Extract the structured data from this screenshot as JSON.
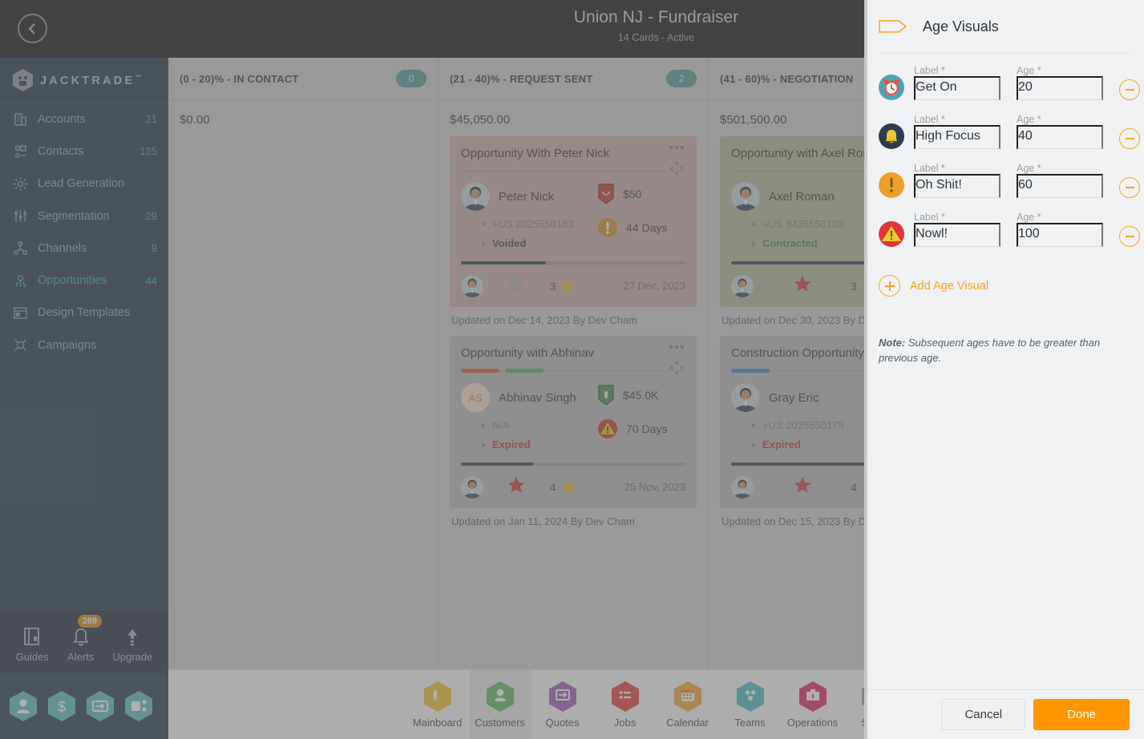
{
  "sidebar": {
    "brand": "JACKTRADE",
    "brand_tm": "™",
    "back_icon": "chevron-left-icon",
    "items": [
      {
        "label": "Accounts",
        "count": "21",
        "icon": "building-icon",
        "active": false
      },
      {
        "label": "Contacts",
        "count": "125",
        "icon": "contacts-icon",
        "active": false
      },
      {
        "label": "Lead Generation",
        "count": "",
        "icon": "lead-generation-icon",
        "active": false
      },
      {
        "label": "Segmentation",
        "count": "29",
        "icon": "segmentation-icon",
        "active": false
      },
      {
        "label": "Channels",
        "count": "9",
        "icon": "channels-icon",
        "active": false
      },
      {
        "label": "Opportunities",
        "count": "44",
        "icon": "opportunities-icon",
        "active": true
      },
      {
        "label": "Design Templates",
        "count": "",
        "icon": "design-templates-icon",
        "active": false
      },
      {
        "label": "Campaigns",
        "count": "",
        "icon": "campaigns-icon",
        "active": false
      }
    ],
    "bottom": [
      {
        "label": "Guides",
        "icon": "book-icon",
        "badge": ""
      },
      {
        "label": "Alerts",
        "icon": "bell-icon",
        "badge": "269"
      },
      {
        "label": "Upgrade",
        "icon": "upload-arrow-icon",
        "badge": ""
      }
    ],
    "hex_shortcuts": [
      "person-hex-icon",
      "dollar-hex-icon",
      "payment-hex-icon",
      "workflow-hex-icon"
    ]
  },
  "header": {
    "title": "Union NJ - Fundraiser",
    "subtitle": "14 Cards - Active",
    "next_icon": "chevron-right-icon"
  },
  "board": {
    "columns": [
      {
        "title": "(0 - 20)% - IN CONTACT",
        "count": "0",
        "total": "$0.00",
        "cards": []
      },
      {
        "title": "(21 - 40)% - REQUEST SENT",
        "count": "2",
        "total": "$45,050.00",
        "cards": [
          {
            "title": "Opportunity With Peter Nick",
            "bg": "#c8aaa6",
            "segments": [],
            "person": "Peter Nick",
            "avatar_type": "photo",
            "initials": "",
            "phone": "+US 2025550183",
            "status": "Voided",
            "status_class": "b-voided",
            "amount": "$50",
            "amount_icon": "shield-red-icon",
            "days": "44 Days",
            "days_icon": "warning-orange-circle-icon",
            "progress": 38,
            "rating_left": "star-grey-icon",
            "rating_count": "3",
            "rating_icon": "star-yellow-icon",
            "date": "27 Dec, 2023",
            "updated": "Updated on Dec 14, 2023 By Dev Cham"
          },
          {
            "title": "Opportunity with Abhinav",
            "bg": "#b9b9b9",
            "segments": [
              "#d4572a",
              "#4caf50"
            ],
            "person": "Abhinav Singh",
            "avatar_type": "initials",
            "initials": "AS",
            "phone": "N/A",
            "status": "Expired",
            "status_class": "b-expired",
            "amount": "$45.0K",
            "amount_icon": "shield-green-icon",
            "days": "70 Days",
            "days_icon": "warning-red-triangle-icon",
            "progress": 32,
            "rating_left": "star-red-icon",
            "rating_count": "4",
            "rating_icon": "star-yellow-icon",
            "date": "25 Nov, 2023",
            "updated": "Updated on Jan 11, 2024 By Dev Cham"
          }
        ]
      },
      {
        "title": "(41 - 60)% - NEGOTIATION",
        "count": "",
        "total": "$501,500.00",
        "cards": [
          {
            "title": "Opportunity with Axel Roman",
            "bg": "#b3b79c",
            "segments": [],
            "person": "Axel Roman",
            "avatar_type": "photo",
            "initials": "",
            "phone": "+US 8435550109",
            "status": "Contracted",
            "status_class": "b-contracted",
            "amount": "",
            "amount_icon": "",
            "days": "",
            "days_icon": "",
            "progress": 100,
            "rating_left": "star-red-icon",
            "rating_count": "3",
            "rating_icon": "star-yellow-icon",
            "date": "",
            "updated": "Updated on Dec 30, 2023 By D"
          },
          {
            "title": "Construction Opportunity Eric",
            "bg": "#b9b9b9",
            "segments": [
              "#3f7fd0"
            ],
            "person": "Gray Eric",
            "avatar_type": "photo",
            "initials": "",
            "phone": "+US 2025550175",
            "status": "Expired",
            "status_class": "b-expired",
            "amount": "",
            "amount_icon": "",
            "days": "",
            "days_icon": "",
            "progress": 92,
            "rating_left": "star-red-icon",
            "rating_count": "4",
            "rating_icon": "star-yellow-icon",
            "date": "",
            "updated": "Updated on Dec 15, 2023 By D"
          }
        ]
      }
    ]
  },
  "appbar": {
    "items": [
      {
        "label": "Mainboard",
        "icon": "mainboard-hex-icon",
        "color": "#f5c02e",
        "active": false
      },
      {
        "label": "Customers",
        "icon": "customers-hex-icon",
        "color": "#5cb85c",
        "active": true
      },
      {
        "label": "Quotes",
        "icon": "quotes-hex-icon",
        "color": "#9b59b6",
        "active": false
      },
      {
        "label": "Jobs",
        "icon": "jobs-hex-icon",
        "color": "#e23b3b",
        "active": false
      },
      {
        "label": "Calendar",
        "icon": "calendar-hex-icon",
        "color": "#f0a828",
        "active": false
      },
      {
        "label": "Teams",
        "icon": "teams-hex-icon",
        "color": "#45bcc4",
        "active": false
      },
      {
        "label": "Operations",
        "icon": "operations-hex-icon",
        "color": "#e0245e",
        "active": false
      },
      {
        "label": "Setup",
        "icon": "setup-hex-icon",
        "color": "#9e9e9e",
        "active": false
      }
    ],
    "avatar": "user-avatar"
  },
  "panel": {
    "tag_icon": "tag-outline-icon",
    "title": "Age Visuals",
    "label_caption": "Label *",
    "age_caption": "Age *",
    "rows": [
      {
        "icon": "alarm-clock-icon",
        "label": "Get On",
        "age": "20",
        "minus_icon": "minus-circle-icon"
      },
      {
        "icon": "bell-icon",
        "label": "High Focus",
        "age": "40",
        "minus_icon": "minus-circle-icon"
      },
      {
        "icon": "exclamation-circle-icon",
        "label": "Oh Shit!",
        "age": "60",
        "minus_icon": "minus-circle-icon"
      },
      {
        "icon": "warning-triangle-icon",
        "label": "Nowl!",
        "age": "100",
        "minus_icon": "minus-circle-icon"
      }
    ],
    "add_label": "Add Age Visual",
    "add_icon": "plus-circle-icon",
    "note_prefix": "Note:",
    "note_text": " Subsequent ages have to be greater than previous age.",
    "cancel_label": "Cancel",
    "done_label": "Done"
  },
  "colors": {
    "accent_orange": "#f5a623",
    "done_orange": "#ff9500",
    "teal": "#4f9c93",
    "sidebar_bg": "#22333f",
    "active_nav": "#3aab9a"
  }
}
